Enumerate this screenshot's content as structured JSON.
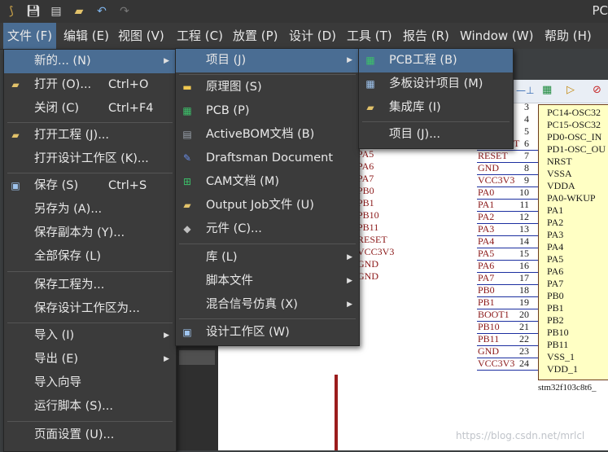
{
  "app": {
    "title": "PC"
  },
  "menubar": [
    "文件 (F)",
    "编辑 (E)",
    "视图 (V)",
    "工程 (C)",
    "放置 (P)",
    "设计 (D)",
    "工具 (T)",
    "报告 (R)",
    "Window (W)",
    "帮助 (H)"
  ],
  "file_menu": [
    {
      "label": "新的... (N)",
      "shortcut": "",
      "submenu": true
    },
    {
      "label": "打开 (O)...",
      "shortcut": "Ctrl+O"
    },
    {
      "label": "关闭 (C)",
      "shortcut": "Ctrl+F4"
    },
    {
      "label": "打开工程 (J)...",
      "shortcut": ""
    },
    {
      "label": "打开设计工作区 (K)...",
      "shortcut": ""
    },
    {
      "label": "保存 (S)",
      "shortcut": "Ctrl+S"
    },
    {
      "label": "另存为 (A)...",
      "shortcut": ""
    },
    {
      "label": "保存副本为 (Y)...",
      "shortcut": ""
    },
    {
      "label": "全部保存 (L)",
      "shortcut": ""
    },
    {
      "label": "保存工程为...",
      "shortcut": ""
    },
    {
      "label": "保存设计工作区为...",
      "shortcut": ""
    },
    {
      "label": "导入 (I)",
      "shortcut": "",
      "submenu": true
    },
    {
      "label": "导出 (E)",
      "shortcut": "",
      "submenu": true
    },
    {
      "label": "导入向导",
      "shortcut": ""
    },
    {
      "label": "运行脚本 (S)...",
      "shortcut": ""
    },
    {
      "label": "页面设置 (U)...",
      "shortcut": ""
    }
  ],
  "new_menu": [
    {
      "label": "项目 (J)",
      "submenu": true
    },
    {
      "label": "原理图 (S)"
    },
    {
      "label": "PCB (P)"
    },
    {
      "label": "ActiveBOM文档 (B)"
    },
    {
      "label": "Draftsman Document"
    },
    {
      "label": "CAM文档 (M)"
    },
    {
      "label": "Output Job文件 (U)"
    },
    {
      "label": "元件 (C)..."
    },
    {
      "label": "库 (L)",
      "submenu": true
    },
    {
      "label": "脚本文件",
      "submenu": true
    },
    {
      "label": "混合信号仿真 (X)",
      "submenu": true
    },
    {
      "label": "设计工作区 (W)"
    }
  ],
  "project_menu": [
    {
      "label": "PCB工程 (B)"
    },
    {
      "label": "多板设计项目 (M)"
    },
    {
      "label": "集成库 (I)"
    },
    {
      "label": "项目 (J)..."
    }
  ],
  "schematic": {
    "pin_numbers": [
      "3",
      "4",
      "5",
      "6",
      "7",
      "8",
      "9",
      "10",
      "11",
      "12",
      "13",
      "14",
      "15",
      "16",
      "17",
      "18",
      "19",
      "20",
      "21",
      "22",
      "23",
      "24"
    ],
    "pin_labels": [
      "PC14-OSC32",
      "PC15-OSC32",
      "PD0-OSC_IN",
      "PD1-OSC_OU",
      "NRST",
      "VSSA",
      "VDDA",
      "PA0-WKUP",
      "PA1",
      "PA2",
      "PA3",
      "PA4",
      "PA5",
      "PA6",
      "PA7",
      "PB0",
      "PB1",
      "PB2",
      "PB10",
      "PB11",
      "VSS_1",
      "VDD_1"
    ],
    "nets_right": [
      "T",
      "RESET",
      "GND",
      "VCC3V3",
      "PA0",
      "PA1",
      "PA2",
      "PA3",
      "PA4",
      "PA5",
      "PA6",
      "PA7",
      "PB0",
      "PB1",
      "BOOT1",
      "PB10",
      "PB11",
      "GND",
      "VCC3V3"
    ],
    "nets_left": [
      "PA5",
      "PA6",
      "PA7",
      "PB0",
      "PB1",
      "PB10",
      "PB11",
      "RESET",
      "VCC3V3",
      "GND",
      "GND"
    ],
    "chip_name": "stm32f103c8t6_"
  },
  "watermark": "https://blog.csdn.net/mrlcl"
}
